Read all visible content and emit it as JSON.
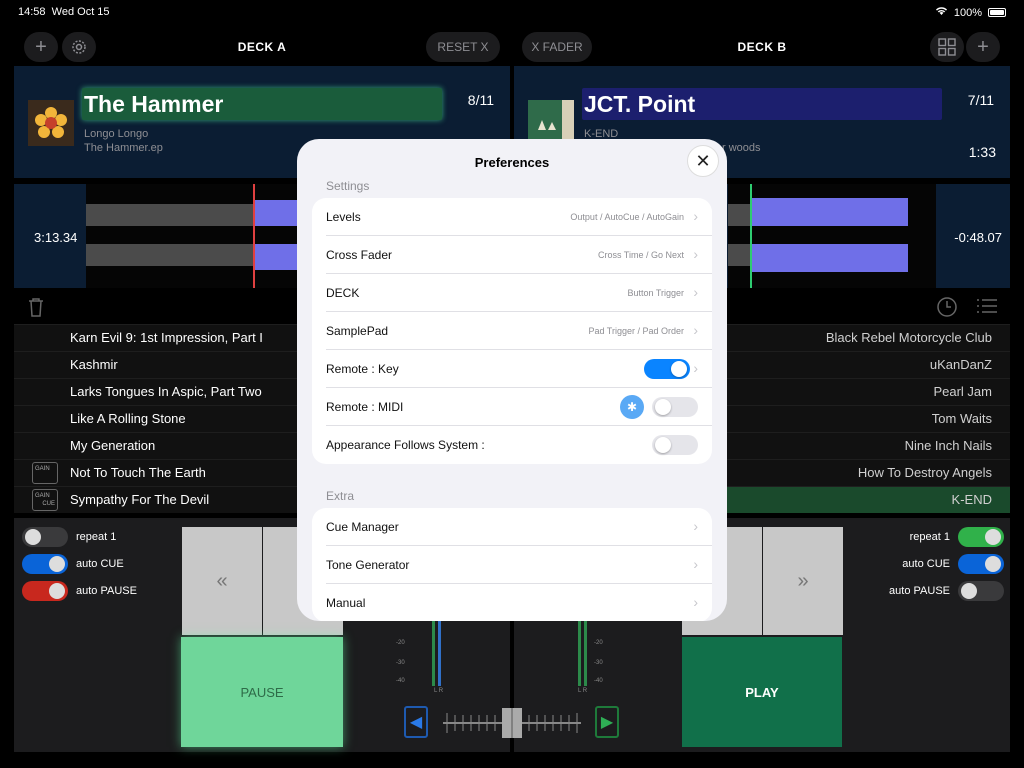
{
  "status": {
    "time": "14:58",
    "date": "Wed Oct 15",
    "battery": "100%"
  },
  "deckA": {
    "title": "DECK A",
    "reset_label": "RESET X",
    "track": {
      "title": "The Hammer",
      "artist": "Longo Longo",
      "album": "The Hammer.ep",
      "count": "8/11"
    },
    "elapsed": "3:13.34",
    "tracklist": [
      "Karn Evil 9: 1st Impression, Part I",
      "Kashmir",
      "Larks Tongues In Aspic, Part Two",
      "Like A Rolling Stone",
      "My Generation",
      "Not To Touch The Earth",
      "Sympathy For The Devil"
    ],
    "gain_label": "GAIN",
    "cue_label": "CUE",
    "toggles": [
      {
        "label": "repeat 1",
        "color": "#3a3a3c"
      },
      {
        "label": "auto CUE",
        "color": "#0a64d8"
      },
      {
        "label": "auto PAUSE",
        "color": "#c8281e"
      }
    ],
    "pause_label": "PAUSE",
    "rewind_label": "«"
  },
  "deckB": {
    "title": "DECK B",
    "xfader_label": "X FADER",
    "track": {
      "title": "JCT. Point",
      "artist": "K-END",
      "album": "r woods",
      "count": "7/11",
      "remaining": "1:33"
    },
    "remaining_wave": "-0:48.07",
    "tracklist": [
      "Black Rebel Motorcycle Club",
      "uKanDanZ",
      "Pearl Jam",
      "Tom Waits",
      "Nine Inch Nails",
      "How To Destroy Angels",
      "K-END"
    ],
    "toggles": [
      {
        "label": "repeat 1",
        "color": "#30b14a"
      },
      {
        "label": "auto CUE",
        "color": "#0a64d8"
      },
      {
        "label": "auto PAUSE",
        "color": "#3a3a3c"
      }
    ],
    "play_label": "PLAY",
    "forward_label": "»"
  },
  "meter": {
    "ticks": [
      "-20",
      "-30",
      "-40"
    ],
    "lr": "L R"
  },
  "preferences": {
    "title": "Preferences",
    "settings_label": "Settings",
    "extra_label": "Extra",
    "settings": [
      {
        "label": "Levels",
        "detail": "Output / AutoCue / AutoGain"
      },
      {
        "label": "Cross Fader",
        "detail": "Cross Time / Go Next"
      },
      {
        "label": "DECK",
        "detail": "Button Trigger"
      },
      {
        "label": "SamplePad",
        "detail": "Pad Trigger / Pad Order"
      },
      {
        "label": "Remote : Key",
        "detail": ""
      },
      {
        "label": "Remote : MIDI",
        "detail": ""
      },
      {
        "label": "Appearance Follows System :",
        "detail": ""
      }
    ],
    "extra": [
      {
        "label": "Cue Manager"
      },
      {
        "label": "Tone Generator"
      },
      {
        "label": "Manual"
      }
    ]
  }
}
